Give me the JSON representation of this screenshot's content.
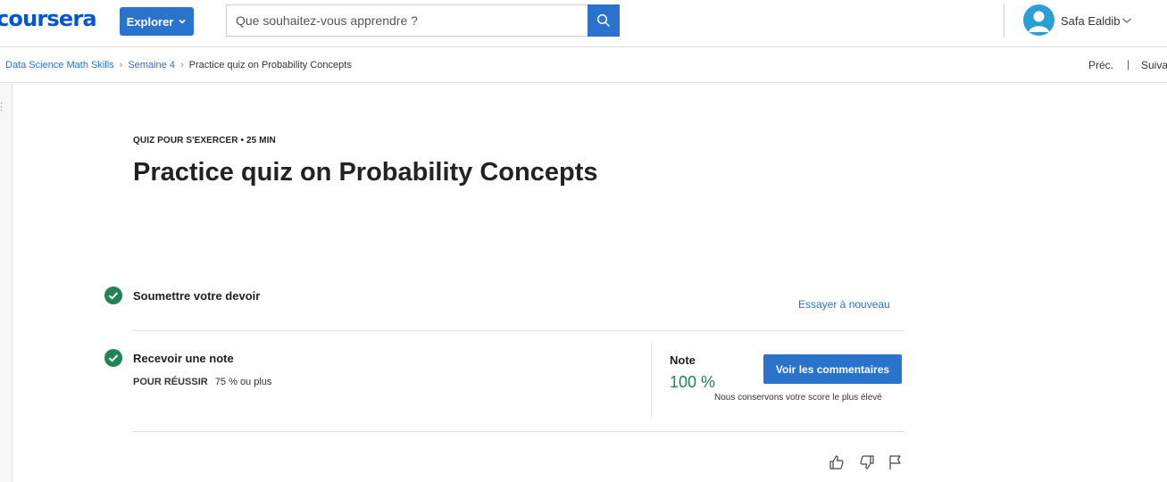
{
  "header": {
    "logo_text": "coursera",
    "explore_label": "Explorer",
    "search_placeholder": "Que souhaitez-vous apprendre ?",
    "username": "Safa Ealdib"
  },
  "breadcrumb": {
    "items": [
      "Data Science Math Skills",
      "Semaine 4",
      "Practice quiz on Probability Concepts"
    ],
    "prev_label": "Préc.",
    "separator": "|",
    "next_label": "Suiva"
  },
  "quiz": {
    "meta": "QUIZ POUR S'EXERCER • 25  MIN",
    "title": "Practice quiz on Probability Concepts",
    "submit_step": {
      "label": "Soumettre votre devoir",
      "retry_label": "Essayer à nouveau"
    },
    "grade_step": {
      "label": "Recevoir une note",
      "pass_key": "POUR RÉUSSIR",
      "pass_value": "75 % ou plus",
      "note_label": "Note",
      "note_value": "100 %",
      "feedback_button": "Voir les commentaires",
      "keep_score_note": "Nous conservons votre score le plus élevé"
    }
  },
  "colors": {
    "brand": "#0056d2",
    "primary_button": "#2a73cc",
    "success": "#1f8354"
  },
  "icons": {
    "search": "search-icon",
    "avatar": "user-avatar-icon",
    "check": "check-circle-icon",
    "like": "thumbs-up-icon",
    "dislike": "thumbs-down-icon",
    "flag": "flag-icon"
  }
}
